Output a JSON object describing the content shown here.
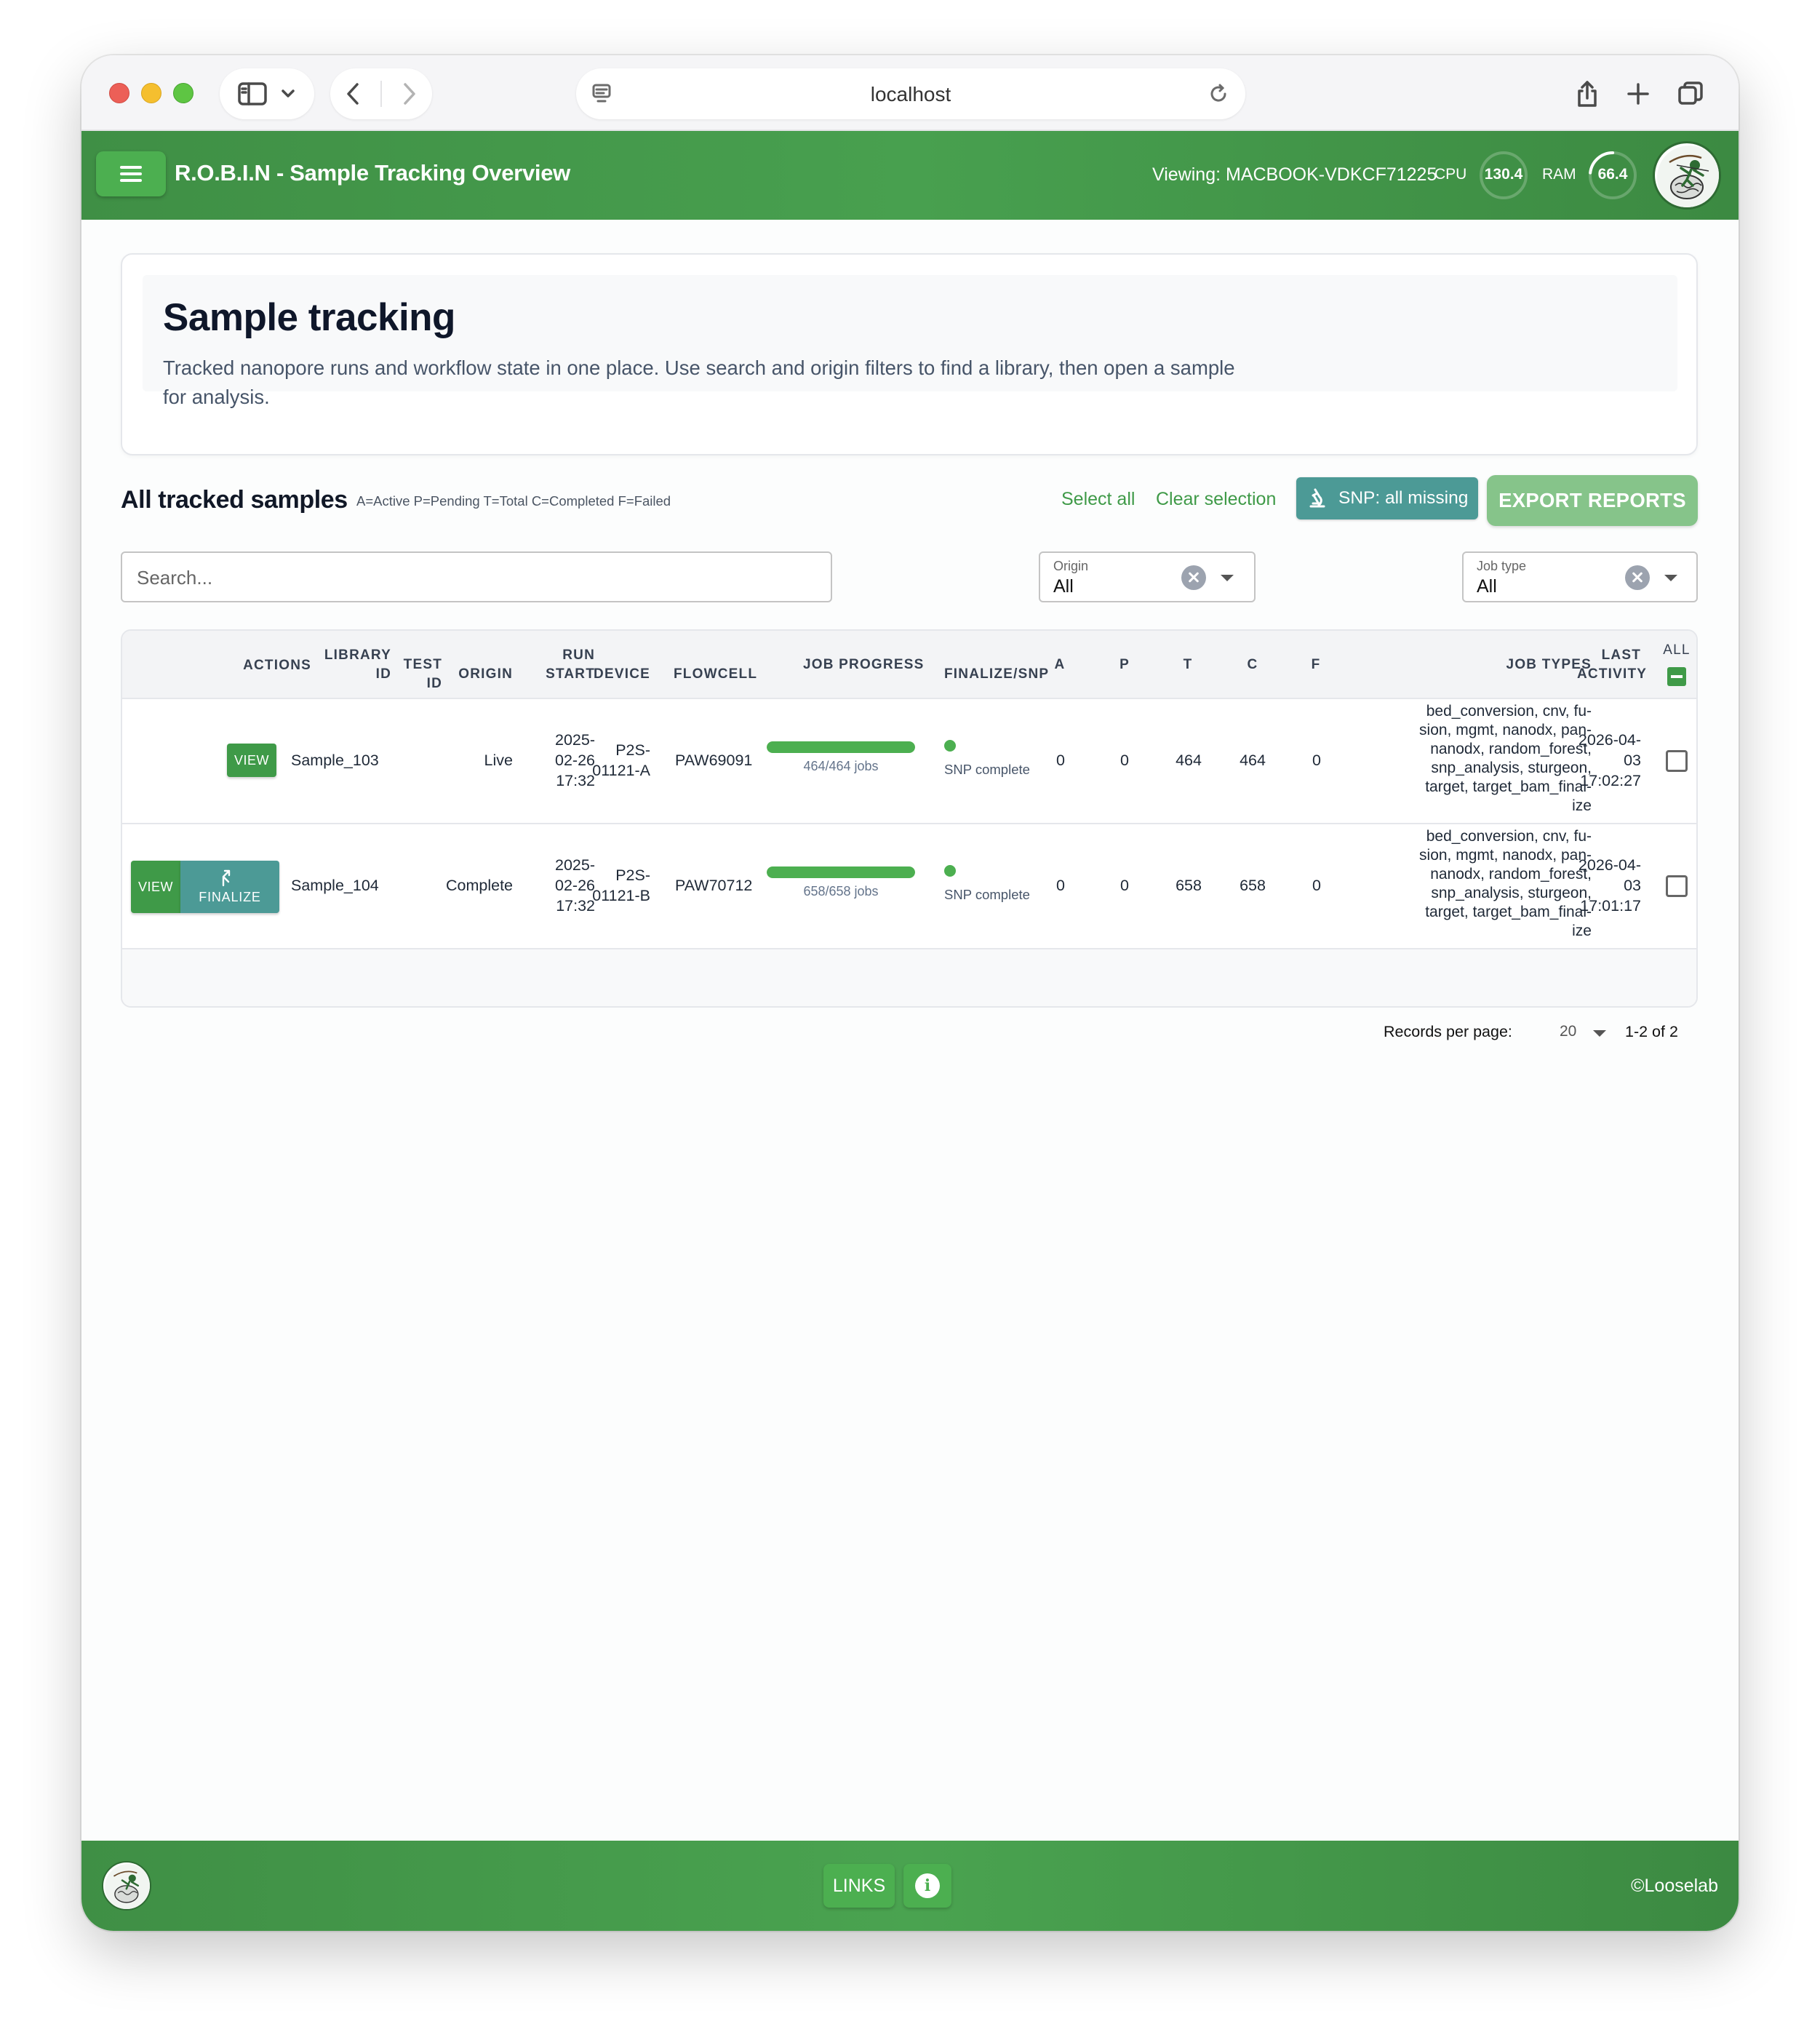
{
  "browser": {
    "url": "localhost"
  },
  "header": {
    "title": "R.O.B.I.N - Sample Tracking Overview",
    "viewing": "Viewing: MACBOOK-VDKCF71225",
    "cpu_label": "CPU",
    "cpu_value": "130.4",
    "ram_label": "RAM",
    "ram_value": "66.4",
    "ram_fraction": 0.664
  },
  "intro": {
    "title": "Sample tracking",
    "description": "Tracked nanopore runs and workflow state in one place. Use search and origin filters to find a library, then open a sample for analysis."
  },
  "section": {
    "title": "All tracked samples",
    "legend": "A=Active P=Pending T=Total C=Completed F=Failed",
    "select_all": "Select all",
    "clear_selection": "Clear selection",
    "snp_button": "SNP: all missing",
    "export_button": "EXPORT REPORTS"
  },
  "filters": {
    "search_placeholder": "Search...",
    "origin_label": "Origin",
    "origin_value": "All",
    "jobtype_label": "Job type",
    "jobtype_value": "All"
  },
  "table": {
    "headers": {
      "actions": "ACTIONS",
      "library_id_1": "LIBRARY",
      "library_id_2": "ID",
      "test_id_1": "TEST",
      "test_id_2": "ID",
      "origin": "ORIGIN",
      "run_start_1": "RUN",
      "run_start_2": "START",
      "device": "DEVICE",
      "flowcell": "FLOWCELL",
      "job_progress": "JOB PROGRESS",
      "finalize_snp": "FINALIZE/SNP",
      "a": "A",
      "p": "P",
      "t": "T",
      "c": "C",
      "f": "F",
      "job_types": "JOB TYPES",
      "last_activity_1": "LAST",
      "last_activity_2": "ACTIVITY",
      "all": "ALL"
    },
    "rows": [
      {
        "view_label": "VIEW",
        "library_id": "Sample_103",
        "test_id": "",
        "origin": "Live",
        "run_start_1": "2025-",
        "run_start_2": "02-26",
        "run_start_3": "17:32",
        "device_1": "P2S-",
        "device_2": "01121-A",
        "flowcell": "PAW69091",
        "progress_label": "464/464 jobs",
        "progress_fraction": 1.0,
        "snp_status": "SNP complete",
        "a": "0",
        "p": "0",
        "t": "464",
        "c": "464",
        "f": "0",
        "job_types": [
          "bed_conversion, cnv, fu-",
          "sion, mgmt, nanodx, pan-",
          "nanodx, random_forest,",
          "snp_analysis, sturgeon,",
          "target, target_bam_final-",
          "ize"
        ],
        "last_activity_1": "2026-04-",
        "last_activity_2": "03",
        "last_activity_3": "17:02:27"
      },
      {
        "view_label": "VIEW",
        "finalize_label": "FINALIZE",
        "library_id": "Sample_104",
        "test_id": "",
        "origin": "Complete",
        "run_start_1": "2025-",
        "run_start_2": "02-26",
        "run_start_3": "17:32",
        "device_1": "P2S-",
        "device_2": "01121-B",
        "flowcell": "PAW70712",
        "progress_label": "658/658 jobs",
        "progress_fraction": 1.0,
        "snp_status": "SNP complete",
        "a": "0",
        "p": "0",
        "t": "658",
        "c": "658",
        "f": "0",
        "job_types": [
          "bed_conversion, cnv, fu-",
          "sion, mgmt, nanodx, pan-",
          "nanodx, random_forest,",
          "snp_analysis, sturgeon,",
          "target, target_bam_final-",
          "ize"
        ],
        "last_activity_1": "2026-04-",
        "last_activity_2": "03",
        "last_activity_3": "17:01:17"
      }
    ],
    "pagination": {
      "records_per_page_label": "Records per page:",
      "records_per_page_value": "20",
      "range": "1-2 of 2"
    }
  },
  "footer": {
    "links_label": "LINKS",
    "copyright": "©Looselab"
  },
  "colors": {
    "brand_green": "#48a04f",
    "button_green": "#4caf50",
    "teal": "#4c9a96",
    "export_green": "#86c48a"
  }
}
